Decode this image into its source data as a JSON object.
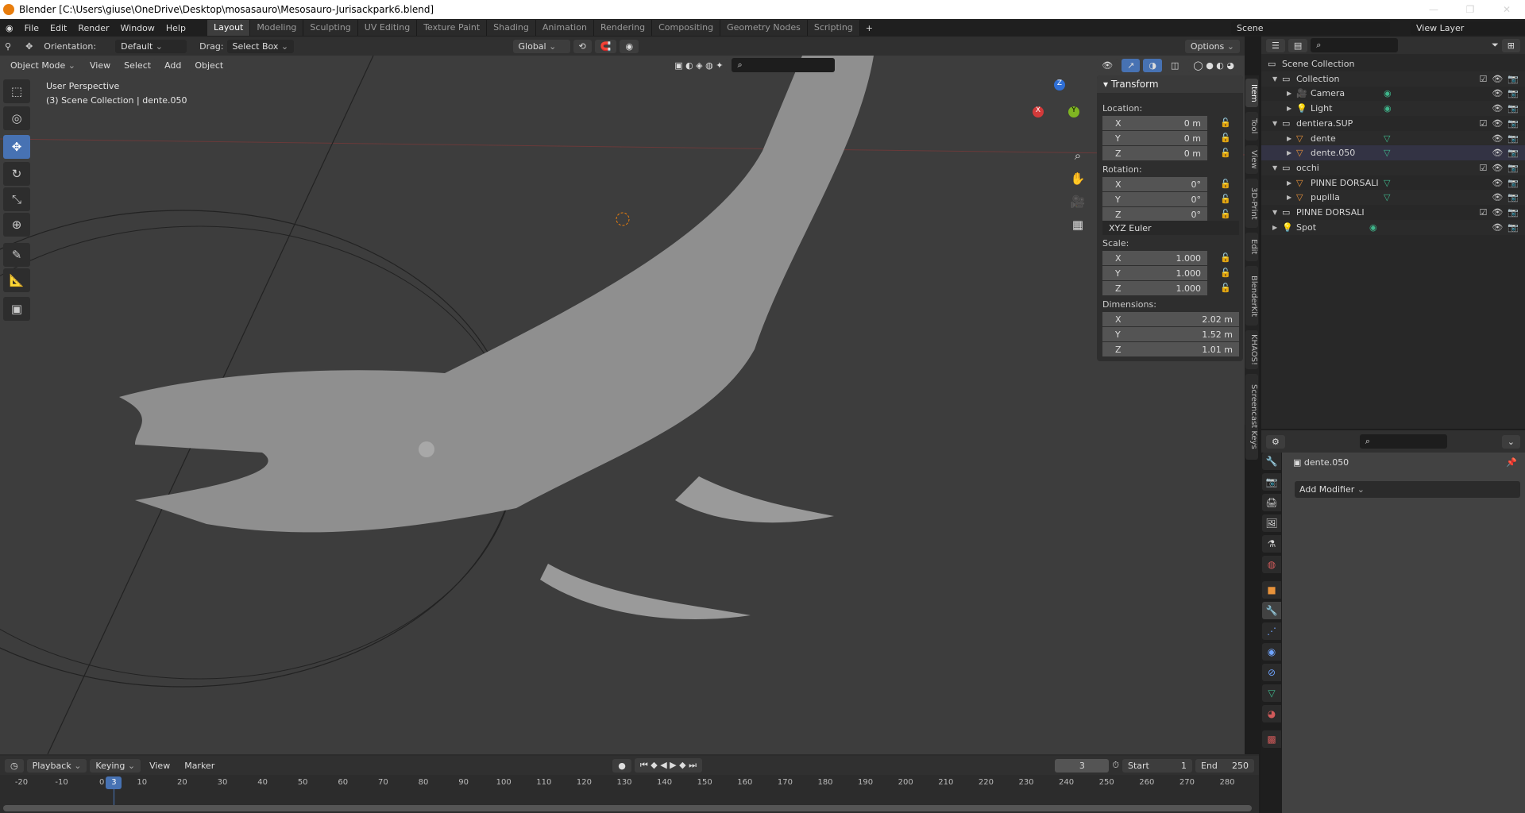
{
  "title": "Blender [C:\\Users\\giuse\\OneDrive\\Desktop\\mosasauro\\Mesosauro-Jurisackpark6.blend]",
  "menu": [
    "File",
    "Edit",
    "Render",
    "Window",
    "Help"
  ],
  "workspaces": [
    "Layout",
    "Modeling",
    "Sculpting",
    "UV Editing",
    "Texture Paint",
    "Shading",
    "Animation",
    "Rendering",
    "Compositing",
    "Geometry Nodes",
    "Scripting"
  ],
  "active_workspace": "Layout",
  "scene": "Scene",
  "view_layer": "View Layer",
  "toolbar": {
    "orientation_label": "Orientation:",
    "orientation": "Default",
    "drag_label": "Drag:",
    "drag": "Select Box",
    "transform_orientation": "Global",
    "options": "Options"
  },
  "viewport_header": {
    "mode": "Object Mode",
    "items": [
      "View",
      "Select",
      "Add",
      "Object"
    ]
  },
  "overlay": {
    "perspective": "User Perspective",
    "collection": "(3) Scene Collection | dente.050"
  },
  "transform": {
    "title": "Transform",
    "location_label": "Location:",
    "location": [
      {
        "axis": "X",
        "value": "0 m"
      },
      {
        "axis": "Y",
        "value": "0 m"
      },
      {
        "axis": "Z",
        "value": "0 m"
      }
    ],
    "rotation_label": "Rotation:",
    "rotation": [
      {
        "axis": "X",
        "value": "0°"
      },
      {
        "axis": "Y",
        "value": "0°"
      },
      {
        "axis": "Z",
        "value": "0°"
      }
    ],
    "rotation_mode": "XYZ Euler",
    "scale_label": "Scale:",
    "scale": [
      {
        "axis": "X",
        "value": "1.000"
      },
      {
        "axis": "Y",
        "value": "1.000"
      },
      {
        "axis": "Z",
        "value": "1.000"
      }
    ],
    "dimensions_label": "Dimensions:",
    "dimensions": [
      {
        "axis": "X",
        "value": "2.02 m"
      },
      {
        "axis": "Y",
        "value": "1.52 m"
      },
      {
        "axis": "Z",
        "value": "1.01 m"
      }
    ]
  },
  "sidebar_tabs": [
    "Item",
    "Tool",
    "View",
    "3D-Print",
    "Edit",
    "BlenderKit",
    "KHAOS!",
    "Screencast Keys"
  ],
  "outliner": [
    {
      "name": "Scene Collection",
      "level": 0,
      "icon": "collection",
      "check": false
    },
    {
      "name": "Collection",
      "level": 1,
      "icon": "collection",
      "check": true
    },
    {
      "name": "Camera",
      "level": 2,
      "icon": "camera",
      "check": false
    },
    {
      "name": "Light",
      "level": 2,
      "icon": "light",
      "check": false
    },
    {
      "name": "dentiera.SUP",
      "level": 1,
      "icon": "collection",
      "check": true
    },
    {
      "name": "dente",
      "level": 2,
      "icon": "mesh",
      "check": false
    },
    {
      "name": "dente.050",
      "level": 2,
      "icon": "mesh",
      "check": false
    },
    {
      "name": "occhi",
      "level": 1,
      "icon": "collection",
      "check": true
    },
    {
      "name": "PINNE DORSALI",
      "level": 2,
      "icon": "mesh",
      "check": false
    },
    {
      "name": "pupilla",
      "level": 2,
      "icon": "mesh",
      "check": false
    },
    {
      "name": "PINNE DORSALI",
      "level": 1,
      "icon": "collection",
      "check": true
    },
    {
      "name": "Spot",
      "level": 1,
      "icon": "light",
      "check": false
    }
  ],
  "properties": {
    "object": "dente.050",
    "add_modifier": "Add Modifier"
  },
  "timeline": {
    "menus": [
      "Playback",
      "Keying",
      "View",
      "Marker"
    ],
    "current_frame": "3",
    "start_label": "Start",
    "start": "1",
    "end_label": "End",
    "end": "250",
    "ticks": [
      "-20",
      "-10",
      "0",
      "10",
      "20",
      "30",
      "40",
      "50",
      "60",
      "70",
      "80",
      "90",
      "100",
      "110",
      "120",
      "130",
      "140",
      "150",
      "160",
      "170",
      "180",
      "190",
      "200",
      "210",
      "220",
      "230",
      "240",
      "250",
      "260",
      "270",
      "280"
    ]
  },
  "colors": {
    "accent": "#4772b3",
    "object_orange": "#e8923a",
    "mesh_green": "#3fb68b"
  }
}
